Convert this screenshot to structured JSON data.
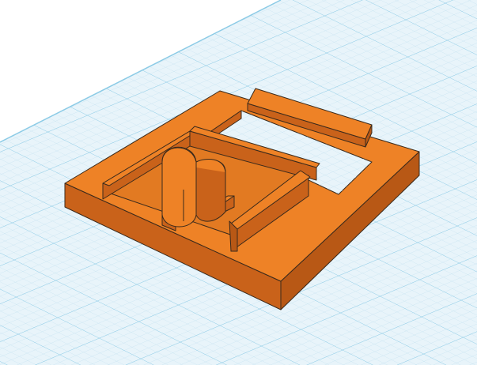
{
  "workplane": {
    "background_color": "#ffffff",
    "plane_color": "#e8f4fa",
    "grid_minor_color": "#bfe0ef",
    "grid_major_color": "#8ccbe6",
    "grid_on": true
  },
  "model": {
    "object_name": "",
    "top_face_color": "#ee8226",
    "side_face_color": "#c9621a",
    "edge_color": "#3a2a1c",
    "parts": [
      "base-frame",
      "window-opening",
      "back-rail",
      "inner-pocket",
      "pocket-left-wall",
      "pocket-right-wall",
      "front-clip-left",
      "front-clip-right",
      "d-shaped-post"
    ]
  }
}
